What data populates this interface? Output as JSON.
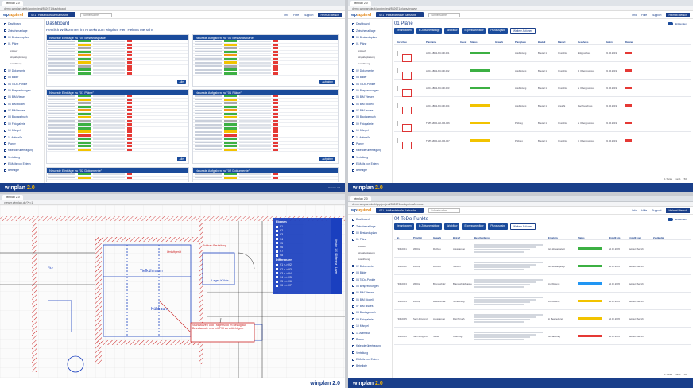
{
  "tl": {
    "tab": "winplan 2.0",
    "url": "demo.winplan.de/#/app/project/852671/dashboard",
    "project": "071 | Hoflandstraße Karlsruhe",
    "search": "Schnellsuche",
    "nav": [
      "Info",
      "Hilfe",
      "Support"
    ],
    "user": "Helmut Mersch",
    "sidebar": [
      "Dashboard",
      "Zwischenablage",
      "00 Bestandspläne",
      "01 Pläne",
      "Entwurf",
      "Eingabeplanung",
      "Ausführung",
      "02 Dokumente",
      "03 Bilder",
      "04 ToDo-Punkte",
      "05 Besprechungen",
      "06 BIM Viewer",
      "06 BIM Modell",
      "07 BIM Issues",
      "08 Bautagebuch",
      "09 Fotogalerie",
      "10 Mängel",
      "11 Aufmaße",
      "Planer",
      "Kalenderübertragung",
      "Verteilung",
      "E-Mails von Extern",
      "Beteiligte"
    ],
    "title": "Dashboard",
    "welcome": "Herzlich Willkommen im Projektraum winplan, Herr Helmut Mersch!",
    "panels": [
      "Neueste Einträge zu \"00 Bestandspläne\"",
      "Neueste Aufgaben zu \"00 Bestandspläne\"",
      "Neueste Einträge zu \"01 Pläne\"",
      "Neueste Aufgaben zu \"01 Pläne\"",
      "Neueste Einträge zu \"02 Dokumente\"",
      "Neueste Aufgaben zu \"02 Dokumente\""
    ],
    "btn_all": "Alle",
    "btn_tasks": "Aufgaben",
    "footer": "winplan",
    "version": "2.0",
    "status": "Version 2.2"
  },
  "tr": {
    "tab": "winplan 2.0",
    "url": "demo.winplan.de/#/app/project/852671/plans/browse",
    "title": "01 Pläne",
    "buttons": [
      "Verantworten",
      "In Zwischenablage",
      "Workflow",
      "Expressworkflow",
      "Planausgabe",
      "Weitere Aktionen"
    ],
    "toggle": "Einblenden",
    "cols": [
      "Vorschau",
      "Planname",
      "Index",
      "Status",
      "Gewerk",
      "Planphase",
      "Bauteil",
      "Planart",
      "Geschoss",
      "Datum",
      "Dateien"
    ],
    "rows": [
      {
        "name": "ARC-EBG1-B0-GR-001",
        "phase": "Ausführung",
        "part": "Bauteil 1",
        "type": "Grundriss",
        "floor": "Erdgeschoss",
        "date": "22.05.2019",
        "status": "g"
      },
      {
        "name": "ARC-EBG1-B0-GR-002",
        "phase": "Ausführung",
        "part": "Bauteil 1",
        "type": "Grundriss",
        "floor": "1. Obergeschoss",
        "date": "22.05.2019",
        "status": "g"
      },
      {
        "name": "ARC-EBG1-B0-GR-003",
        "phase": "Ausführung",
        "part": "Bauteil 1",
        "type": "Grundriss",
        "floor": "2. Obergeschoss",
        "date": "22.05.2019",
        "status": "g"
      },
      {
        "name": "ARC-EBG1-B0-GR-004",
        "phase": "Ausführung",
        "part": "Bauteil 1",
        "type": "Ansicht",
        "floor": "Dachgeschoss",
        "date": "22.05.2019",
        "status": "y"
      },
      {
        "name": "TWP-EBG1-B0-GR-006",
        "phase": "Prüfung",
        "part": "Bauteil 1",
        "type": "Grundriss",
        "floor": "2. Obergeschoss",
        "date": "22.05.2019",
        "status": "y"
      },
      {
        "name": "TWP-EBG1-B0-GR-007",
        "phase": "Prüfung",
        "part": "Bauteil 1",
        "type": "Grundriss",
        "floor": "3. Obergeschoss",
        "date": "22.05.2019",
        "status": "y"
      }
    ],
    "pag": [
      "1 Seite",
      "von 1",
      "50"
    ],
    "footer": "winplan",
    "version": "2.0"
  },
  "br": {
    "tab": "winplan 2.0",
    "url": "demo.winplan.de/#/app/project/852671/todopoints/browse",
    "title": "04 ToDo-Punkte",
    "buttons": [
      "Verantworten",
      "In Zwischenablage",
      "Workflow",
      "Expressworkflow",
      "Planausgabe",
      "Weitere Aktionen"
    ],
    "toggle": "Einblenden",
    "cols": [
      "Nr.",
      "Priorität",
      "Gewerk",
      "Betreff",
      "Beschreibung",
      "Ergebnis",
      "Status",
      "Erstellt am",
      "Erstellt von",
      "Zuständig"
    ],
    "rows": [
      {
        "nr": "TDP-0061",
        "prio": "Wichtig",
        "trade": "Rohbau",
        "subj": "Aussparung",
        "res": "ist aktiv angelegt",
        "st": "g",
        "date": "22.01.2020",
        "by": "Helmut Mersch"
      },
      {
        "nr": "TDP-0062",
        "prio": "Wichtig",
        "trade": "Rohbau",
        "subj": "Stützen",
        "res": "ist aktiv angelegt",
        "st": "g",
        "date": "22.01.2020",
        "by": "Helmut Mersch"
      },
      {
        "nr": "TDP-0063",
        "prio": "Wichtig",
        "trade": "Brandschutz",
        "subj": "Brandschutzklappe",
        "res": "zur Klärung",
        "st": "b",
        "date": "22.01.2020",
        "by": "Helmut Mersch"
      },
      {
        "nr": "TDP-0064",
        "prio": "Wichtig",
        "trade": "Haustechnik",
        "subj": "Schleitzung",
        "res": "zur Klärung",
        "st": "y",
        "date": "22.01.2020",
        "by": "Helmut Mersch"
      },
      {
        "nr": "TDP-0065",
        "prio": "Sehr dringend",
        "trade": "Aussparung",
        "subj": "Durchbruch",
        "res": "in Bearbeitung",
        "st": "y",
        "date": "22.01.2020",
        "by": "Helmut Mersch"
      },
      {
        "nr": "TDP-0066",
        "prio": "Sehr dringend",
        "trade": "Statik",
        "subj": "Unterzug",
        "res": "ist Nachtrag",
        "st": "r",
        "date": "22.01.2020",
        "by": "Helmut Mersch"
      }
    ],
    "pag": [
      "1 Seite",
      "von 1",
      "50"
    ],
    "footer": "winplan",
    "version": "2.0"
  },
  "bl": {
    "tab": "winplan 2.0",
    "url": "viewer.winplan.de/?v=1",
    "labels": [
      "Tiefkühlraum",
      "Kühlraum",
      "Lager Kühle",
      "Flur",
      "Umluftgerät",
      "Rohbau Bauleitung",
      "Stahlstützen und Träger sind im Bezug auf Brandschutz neu mit F90 zu ertüchtigen."
    ],
    "layers_title": "Ebenen",
    "layers": [
      "V1",
      "V2",
      "V3",
      "V4",
      "V5",
      "V6",
      "V7",
      "V8"
    ],
    "layers2_title": "Differenzen",
    "layers2": [
      "V1 <-> V2",
      "V2 <-> V3",
      "V3 <-> V4",
      "V4 <-> V5",
      "V5 <-> V6",
      "V6 <-> V7"
    ],
    "side_label": "Version 1.0 | Differenz | Layer",
    "footer": "winplan",
    "version": "2.0"
  }
}
